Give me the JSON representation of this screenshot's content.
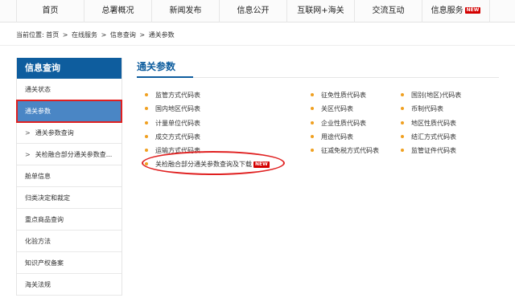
{
  "nav": {
    "items": [
      {
        "label": "首页"
      },
      {
        "label": "总署概况"
      },
      {
        "label": "新闻发布"
      },
      {
        "label": "信息公开"
      },
      {
        "label": "互联网+海关"
      },
      {
        "label": "交流互动"
      },
      {
        "label": "信息服务",
        "badge": "NEW"
      }
    ]
  },
  "breadcrumb": {
    "prefix": "当前位置:",
    "items": [
      "首页",
      "在线服务",
      "信息查询",
      "通关参数"
    ],
    "separator": ">"
  },
  "sidebar": {
    "header": "信息查询",
    "items": [
      {
        "label": "通关状态"
      },
      {
        "label": "通关参数"
      },
      {
        "label": "通关参数查询"
      },
      {
        "label": "关检融合部分通关参数查..."
      },
      {
        "label": "舱单信息"
      },
      {
        "label": "归类决定和裁定"
      },
      {
        "label": "重点商品查询"
      },
      {
        "label": "化验方法"
      },
      {
        "label": "知识产权备案"
      },
      {
        "label": "海关法规"
      }
    ],
    "sub_marker": ">"
  },
  "main": {
    "title": "通关参数",
    "col1": [
      "监管方式代码表",
      "国内地区代码表",
      "计量单位代码表",
      "成交方式代码表",
      "运输方式代码表"
    ],
    "col2": [
      "征免性质代码表",
      "关区代码表",
      "企业性质代码表",
      "用途代码表",
      "征减免税方式代码表"
    ],
    "col3": [
      "国别(地区)代码表",
      "币制代码表",
      "地区性质代码表",
      "结汇方式代码表",
      "监管证件代码表"
    ],
    "special_link": {
      "label": "关检融合部分通关参数查询及下载",
      "badge": "NEW"
    }
  },
  "colors": {
    "brand_blue": "#0e5d9e",
    "active_bg": "#4a86c5",
    "annotation_red": "#e02020",
    "bullet": "#f0a020"
  }
}
